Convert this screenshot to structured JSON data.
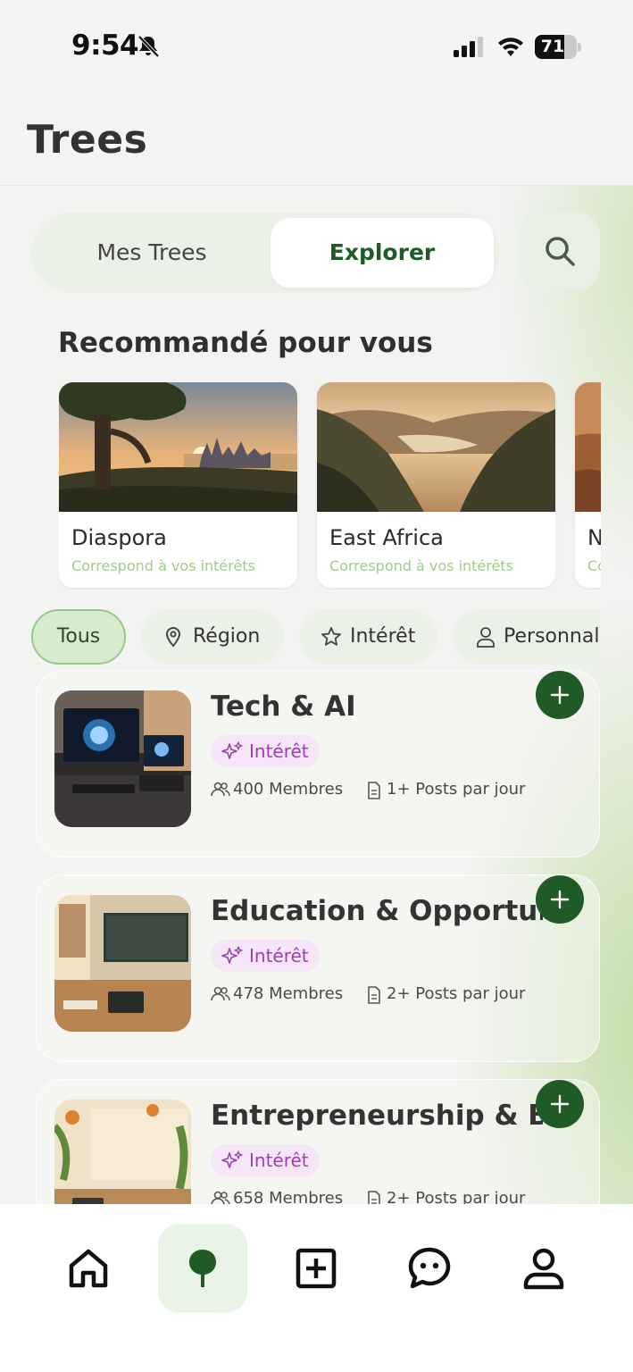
{
  "status_bar": {
    "time": "9:54",
    "battery": "71",
    "battery_level": 0.71
  },
  "header": {
    "title": "Trees"
  },
  "segments": {
    "mine": "Mes Trees",
    "explore": "Explorer"
  },
  "section": {
    "recommended_title": "Recommandé pour vous"
  },
  "recommendations": [
    {
      "name": "Diaspora",
      "subtitle": "Correspond à vos intérêts"
    },
    {
      "name": "East Africa",
      "subtitle": "Correspond à vos intérêts"
    },
    {
      "name": "N",
      "subtitle": "Co"
    }
  ],
  "filters": [
    "Tous",
    "Région",
    "Intérêt",
    "Personnal"
  ],
  "trees": [
    {
      "name": "Tech & AI",
      "badge": "Intérêt",
      "members": "400 Membres",
      "posts": "1+ Posts par jour"
    },
    {
      "name": "Education & Opportunit",
      "badge": "Intérêt",
      "members": "478 Membres",
      "posts": "2+ Posts par jour"
    },
    {
      "name": "Entrepreneurship & Bus",
      "badge": "Intérêt",
      "members": "658 Membres",
      "posts": "2+ Posts par jour"
    }
  ],
  "colors": {
    "accent": "#1f5a27",
    "chip_active": "#d9ebcf",
    "badge_text": "#9b3fb3",
    "subtitle_green": "#9ccd8c"
  },
  "nav_icons": [
    "home-icon",
    "tree-icon",
    "add-square-icon",
    "chat-icon",
    "profile-icon"
  ]
}
